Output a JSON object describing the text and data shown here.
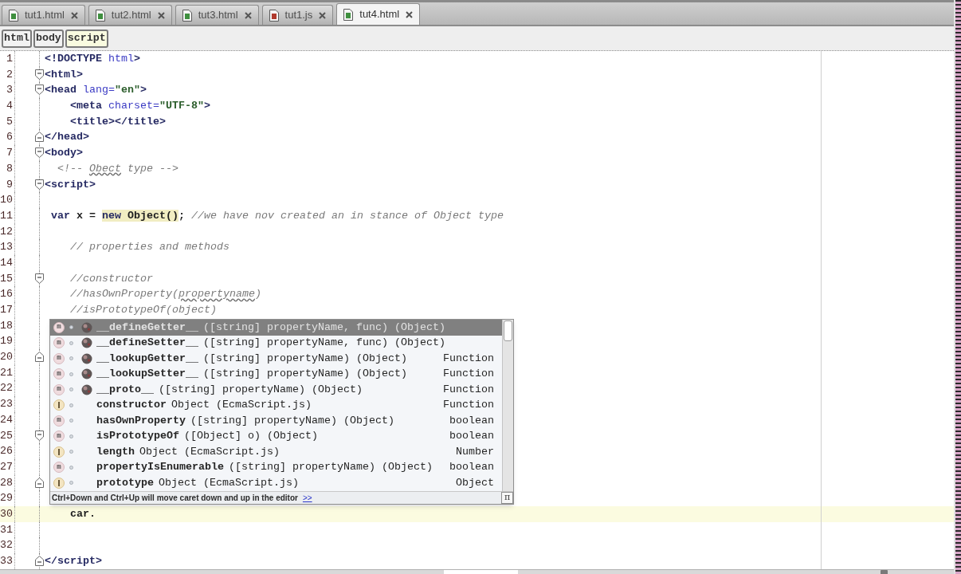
{
  "tabs": [
    {
      "label": "tut1.html",
      "kind": "html",
      "selected": false
    },
    {
      "label": "tut2.html",
      "kind": "html",
      "selected": false
    },
    {
      "label": "tut3.html",
      "kind": "html",
      "selected": false
    },
    {
      "label": "tut1.js",
      "kind": "js",
      "selected": false
    },
    {
      "label": "tut4.html",
      "kind": "html",
      "selected": true
    }
  ],
  "breadcrumbs": [
    {
      "label": "html",
      "selected": false
    },
    {
      "label": "body",
      "selected": false
    },
    {
      "label": "script",
      "selected": true
    }
  ],
  "editor": {
    "lines": [
      {
        "number": "1",
        "fold_start": false,
        "fold_end": false,
        "current": false,
        "segments": [
          {
            "text": "<!DOCTYPE",
            "kind": "tag"
          },
          {
            "text": " html",
            "kind": "name"
          },
          {
            "text": ">",
            "kind": "tag"
          }
        ]
      },
      {
        "number": "2",
        "fold_start": true,
        "fold_end": false,
        "current": false,
        "segments": [
          {
            "text": "<html>",
            "kind": "tag"
          }
        ]
      },
      {
        "number": "3",
        "fold_start": true,
        "fold_end": false,
        "current": false,
        "segments": [
          {
            "text": "<head",
            "kind": "tag"
          },
          {
            "text": " lang=",
            "kind": "name"
          },
          {
            "text": "\"en\"",
            "kind": "string"
          },
          {
            "text": ">",
            "kind": "tag"
          }
        ]
      },
      {
        "number": "4",
        "fold_start": false,
        "fold_end": false,
        "current": false,
        "segments": [
          {
            "text": "    <meta",
            "kind": "tag"
          },
          {
            "text": " charset=",
            "kind": "name"
          },
          {
            "text": "\"UTF-8\"",
            "kind": "string"
          },
          {
            "text": ">",
            "kind": "tag"
          }
        ]
      },
      {
        "number": "5",
        "fold_start": false,
        "fold_end": false,
        "current": false,
        "segments": [
          {
            "text": "    <title></title>",
            "kind": "tag"
          }
        ]
      },
      {
        "number": "6",
        "fold_start": false,
        "fold_end": true,
        "current": false,
        "segments": [
          {
            "text": "</head>",
            "kind": "tag"
          }
        ]
      },
      {
        "number": "7",
        "fold_start": true,
        "fold_end": false,
        "current": false,
        "segments": [
          {
            "text": "<body>",
            "kind": "tag"
          }
        ]
      },
      {
        "number": "8",
        "fold_start": false,
        "fold_end": false,
        "current": false,
        "segments": [
          {
            "text": "  <!-- ",
            "kind": "comment"
          },
          {
            "text": "Obect",
            "kind": "misspelled"
          },
          {
            "text": " type -->",
            "kind": "comment"
          }
        ]
      },
      {
        "number": "9",
        "fold_start": true,
        "fold_end": false,
        "current": false,
        "segments": [
          {
            "text": "<script>",
            "kind": "tag"
          }
        ]
      },
      {
        "number": "10",
        "fold_start": false,
        "fold_end": false,
        "current": false
      },
      {
        "number": "11",
        "fold_start": false,
        "fold_end": false,
        "current": false,
        "segments": [
          {
            "text": " var",
            "kind": "keyword"
          },
          {
            "text": " x = ",
            "kind": "code"
          },
          {
            "text": "new",
            "kind": "marked_keyword"
          },
          {
            "text": " Object()",
            "kind": "marked_code"
          },
          {
            "text": ";",
            "kind": "code"
          },
          {
            "text": " //we have nov created an in stance of Object type",
            "kind": "comment"
          }
        ]
      },
      {
        "number": "12",
        "fold_start": false,
        "fold_end": false,
        "current": false
      },
      {
        "number": "13",
        "fold_start": false,
        "fold_end": false,
        "current": false,
        "segments": [
          {
            "text": "    // properties and methods",
            "kind": "comment"
          }
        ]
      },
      {
        "number": "14",
        "fold_start": false,
        "fold_end": false,
        "current": false
      },
      {
        "number": "15",
        "fold_start": true,
        "fold_end": false,
        "current": false,
        "segments": [
          {
            "text": "    //constructor",
            "kind": "comment"
          }
        ]
      },
      {
        "number": "16",
        "fold_start": false,
        "fold_end": false,
        "current": false,
        "segments": [
          {
            "text": "    //hasOwnProperty(",
            "kind": "comment"
          },
          {
            "text": "propertyname",
            "kind": "misspelled"
          },
          {
            "text": ")",
            "kind": "comment"
          }
        ]
      },
      {
        "number": "17",
        "fold_start": false,
        "fold_end": false,
        "current": false,
        "segments": [
          {
            "text": "    //isPrototypeOf(object)",
            "kind": "comment"
          }
        ]
      },
      {
        "number": "18",
        "fold_start": false,
        "fold_end": false,
        "current": false
      },
      {
        "number": "19",
        "fold_start": false,
        "fold_end": false,
        "current": false
      },
      {
        "number": "20",
        "fold_start": false,
        "fold_end": true,
        "current": false
      },
      {
        "number": "21",
        "fold_start": false,
        "fold_end": false,
        "current": false
      },
      {
        "number": "22",
        "fold_start": false,
        "fold_end": false,
        "current": false
      },
      {
        "number": "23",
        "fold_start": false,
        "fold_end": false,
        "current": false
      },
      {
        "number": "24",
        "fold_start": false,
        "fold_end": false,
        "current": false
      },
      {
        "number": "25",
        "fold_start": true,
        "fold_end": false,
        "current": false
      },
      {
        "number": "26",
        "fold_start": false,
        "fold_end": false,
        "current": false
      },
      {
        "number": "27",
        "fold_start": false,
        "fold_end": false,
        "current": false
      },
      {
        "number": "28",
        "fold_start": false,
        "fold_end": true,
        "current": false
      },
      {
        "number": "29",
        "fold_start": false,
        "fold_end": false,
        "current": false
      },
      {
        "number": "30",
        "fold_start": false,
        "fold_end": false,
        "current": true,
        "segments": [
          {
            "text": "    car.",
            "kind": "code"
          }
        ]
      },
      {
        "number": "31",
        "fold_start": false,
        "fold_end": false,
        "current": false
      },
      {
        "number": "32",
        "fold_start": false,
        "fold_end": false,
        "current": false
      },
      {
        "number": "33",
        "fold_start": false,
        "fold_end": true,
        "current": false,
        "segments": [
          {
            "text": "</script>",
            "kind": "tag"
          }
        ]
      }
    ]
  },
  "completion": {
    "items": [
      {
        "kind": "method",
        "badge": "m",
        "object_icon": true,
        "name": "__defineGetter__",
        "signature": "([string] propertyName, func) (Object)",
        "selected": true
      },
      {
        "kind": "method",
        "badge": "m",
        "object_icon": true,
        "name": "__defineSetter__",
        "signature": "([string] propertyName, func) (Object)",
        "selected": false
      },
      {
        "kind": "method",
        "badge": "m",
        "object_icon": true,
        "name": "__lookupGetter__",
        "signature": "([string] propertyName) (Object)",
        "type": "Function",
        "selected": false
      },
      {
        "kind": "method",
        "badge": "m",
        "object_icon": true,
        "name": "__lookupSetter__",
        "signature": "([string] propertyName) (Object)",
        "type": "Function",
        "selected": false
      },
      {
        "kind": "method",
        "badge": "m",
        "object_icon": true,
        "name": "__proto__",
        "signature": "([string] propertyName) (Object)",
        "type": "Function",
        "selected": false
      },
      {
        "kind": "field",
        "object_icon": false,
        "name": "constructor",
        "signature": "Object (EcmaScript.js)",
        "type": "Function",
        "selected": false
      },
      {
        "kind": "method",
        "badge": "m",
        "object_icon": false,
        "name": "hasOwnProperty",
        "signature": "([string] propertyName) (Object)",
        "type": "boolean",
        "selected": false
      },
      {
        "kind": "method",
        "badge": "m",
        "object_icon": false,
        "name": "isPrototypeOf",
        "signature": "([Object] o) (Object)",
        "type": "boolean",
        "selected": false
      },
      {
        "kind": "field",
        "object_icon": false,
        "name": "length",
        "signature": "Object (EcmaScript.js)",
        "type": "Number",
        "selected": false
      },
      {
        "kind": "method",
        "badge": "m",
        "object_icon": false,
        "name": "propertyIsEnumerable",
        "signature": "([string] propertyName) (Object)",
        "type": "boolean",
        "selected": false
      },
      {
        "kind": "field",
        "object_icon": false,
        "name": "prototype",
        "signature": "Object (EcmaScript.js)",
        "type": "Object",
        "selected": false
      }
    ],
    "hint": "Ctrl+Down and Ctrl+Up will move caret down and up in the editor",
    "more_link": ">>",
    "pi_button": "π"
  }
}
